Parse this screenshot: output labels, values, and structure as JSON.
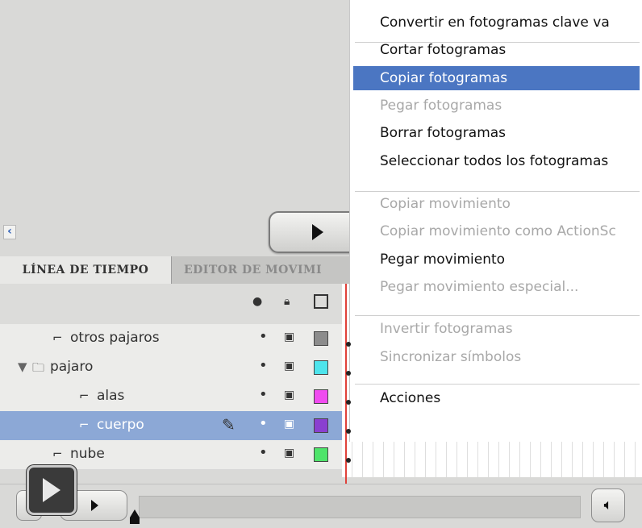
{
  "timeline": {
    "tabs": [
      {
        "label": "LÍNEA DE TIEMPO",
        "active": true
      },
      {
        "label": "EDITOR DE MOVIMI",
        "active": false
      }
    ],
    "header_icons": [
      "eye-icon",
      "lock-icon",
      "outline-icon"
    ],
    "layers": [
      {
        "name": "otros pajaros",
        "type": "layer",
        "indent": 1,
        "color": "#8c8c8c",
        "selected": false
      },
      {
        "name": "pajaro",
        "type": "folder",
        "indent": 0,
        "color": "#4ee4ec",
        "selected": false,
        "expanded": true
      },
      {
        "name": "alas",
        "type": "layer",
        "indent": 2,
        "color": "#f04bf0",
        "selected": false
      },
      {
        "name": "cuerpo",
        "type": "layer",
        "indent": 2,
        "color": "#8a3fd0",
        "selected": true
      },
      {
        "name": "nube",
        "type": "layer",
        "indent": 1,
        "color": "#4ee46a",
        "selected": false
      }
    ]
  },
  "context_menu": {
    "items": [
      {
        "label": "Convertir en fotogramas clave va",
        "enabled": true,
        "highlighted": false
      },
      {
        "separator": true
      },
      {
        "label": "Cortar fotogramas",
        "enabled": true,
        "highlighted": false
      },
      {
        "label": "Copiar fotogramas",
        "enabled": true,
        "highlighted": true
      },
      {
        "label": "Pegar fotogramas",
        "enabled": false,
        "highlighted": false
      },
      {
        "label": "Borrar fotogramas",
        "enabled": true,
        "highlighted": false
      },
      {
        "label": "Seleccionar todos los fotogramas",
        "enabled": true,
        "highlighted": false
      },
      {
        "separator": true
      },
      {
        "label": "Copiar movimiento",
        "enabled": false,
        "highlighted": false
      },
      {
        "label": "Copiar movimiento como ActionSc",
        "enabled": false,
        "highlighted": false
      },
      {
        "label": "Pegar movimiento",
        "enabled": true,
        "highlighted": false
      },
      {
        "label": "Pegar movimiento especial...",
        "enabled": false,
        "highlighted": false
      },
      {
        "separator": true
      },
      {
        "label": "Invertir fotogramas",
        "enabled": false,
        "highlighted": false
      },
      {
        "label": "Sincronizar símbolos",
        "enabled": false,
        "highlighted": false
      },
      {
        "separator": true
      },
      {
        "label": "Acciones",
        "enabled": true,
        "highlighted": false
      }
    ]
  },
  "player": {
    "icons": [
      "play-icon",
      "volume-icon"
    ]
  }
}
